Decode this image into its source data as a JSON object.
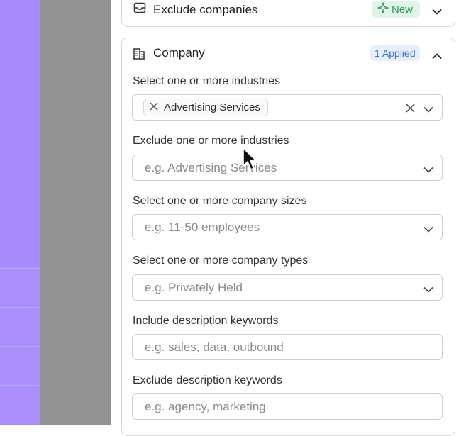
{
  "exclude_companies": {
    "title": "Exclude companies",
    "badge": "New"
  },
  "company": {
    "title": "Company",
    "badge": "1 Applied"
  },
  "fields": {
    "select_industries": {
      "label": "Select one or more industries",
      "chip": "Advertising Services"
    },
    "exclude_industries": {
      "label": "Exclude one or more industries",
      "placeholder": "e.g. Advertising Services"
    },
    "company_sizes": {
      "label": "Select one or more company sizes",
      "placeholder": "e.g. 11-50 employees"
    },
    "company_types": {
      "label": "Select one or more company types",
      "placeholder": "e.g. Privately Held"
    },
    "include_keywords": {
      "label": "Include description keywords",
      "placeholder": "e.g. sales, data, outbound"
    },
    "exclude_keywords": {
      "label": "Exclude description keywords",
      "placeholder": "e.g. agency, marketing"
    }
  },
  "icons": {
    "exclude": "inbox-icon",
    "company": "building-icon",
    "new": "sparkle-icon",
    "collapse": "chevron-up-icon",
    "expand": "chevron-down-icon",
    "remove": "close-icon"
  },
  "colors": {
    "sidebar_purple": "#a78bfa",
    "overlay_gray": "#929292",
    "new_badge_bg": "#e0f4e8",
    "new_badge_text": "#2f9a5a",
    "applied_badge_bg": "#e7eefc",
    "applied_badge_text": "#3b6fcf"
  }
}
